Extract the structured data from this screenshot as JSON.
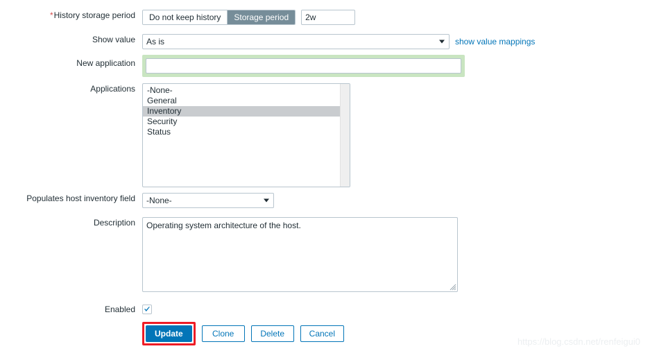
{
  "form": {
    "history_storage": {
      "label": "History storage period",
      "required_marker": "*",
      "options": [
        "Do not keep history",
        "Storage period"
      ],
      "selected": "Storage period",
      "value": "2w"
    },
    "show_value": {
      "label": "Show value",
      "value": "As is",
      "link": "show value mappings"
    },
    "new_application": {
      "label": "New application",
      "value": "",
      "placeholder": ""
    },
    "applications": {
      "label": "Applications",
      "options": [
        "-None-",
        "General",
        "Inventory",
        "Security",
        "Status"
      ],
      "selected": [
        "Inventory"
      ]
    },
    "inventory_field": {
      "label": "Populates host inventory field",
      "value": "-None-"
    },
    "description": {
      "label": "Description",
      "value": "Operating system architecture of the host."
    },
    "enabled": {
      "label": "Enabled",
      "checked": true
    },
    "buttons": {
      "update": "Update",
      "clone": "Clone",
      "delete": "Delete",
      "cancel": "Cancel"
    }
  },
  "watermark": "https://blog.csdn.net/renfeigui0",
  "colors": {
    "accent": "#0275b8",
    "segment_active": "#768d99",
    "highlight_green": "#c9e5c1",
    "annotation_red": "#ee1c25",
    "required_red": "#d64e4e",
    "list_selected": "#c9cccf"
  }
}
